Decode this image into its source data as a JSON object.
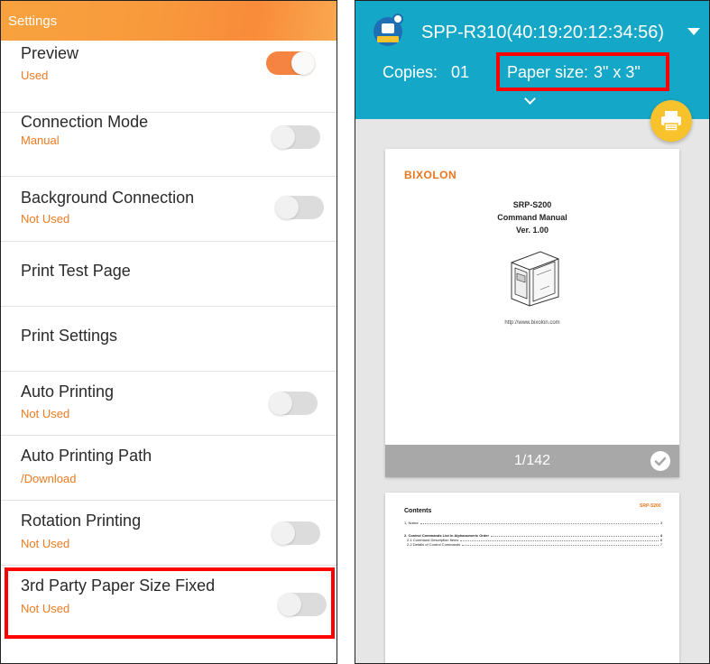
{
  "settings": {
    "header_title": "Settings",
    "items": [
      {
        "title": "Preview",
        "value": "Used",
        "toggle": true
      },
      {
        "title": "Connection Mode",
        "value": "Manual",
        "toggle": false
      },
      {
        "title": "Background Connection",
        "value": "Not Used",
        "toggle": false
      },
      {
        "title": "Print Test Page"
      },
      {
        "title": "Print Settings"
      },
      {
        "title": "Auto Printing",
        "value": "Not Used",
        "toggle": false
      },
      {
        "title": "Auto Printing Path",
        "value": "/Download"
      },
      {
        "title": "Rotation Printing",
        "value": "Not Used",
        "toggle": false
      },
      {
        "title": "3rd Party Paper Size Fixed",
        "value": "Not Used",
        "toggle": false
      }
    ]
  },
  "preview": {
    "device_name": "SPP-R310(40:19:20:12:34:56)",
    "copies_label": "Copies:",
    "copies_value": "01",
    "paper_size_label": "Paper size:",
    "paper_size_value": "3\" x 3\"",
    "page1": {
      "brand": "BIXOLON",
      "title_line1": "SRP-S200",
      "title_line2": "Command Manual",
      "title_line3": "Ver. 1.00",
      "url": "http://www.bixolon.com",
      "page_indicator": "1/142"
    },
    "page2": {
      "brand": "SRP-S200",
      "heading": "Contents",
      "toc": [
        {
          "text": "1. Notice",
          "page": "3"
        },
        {
          "text": "2. Control Commands List in Alphanumeric Order",
          "page": "4"
        },
        {
          "text": "2-1 Command Description Items",
          "page": "6"
        },
        {
          "text": "2-2 Details of Control Commands",
          "page": "7"
        }
      ]
    }
  },
  "colors": {
    "accent_orange": "#f58442",
    "header_teal": "#15a7c7",
    "fab_yellow": "#f7c22b",
    "highlight_red": "#ff0000"
  },
  "icons": [
    "app-printer-icon",
    "dropdown-caret-icon",
    "chevron-down-icon",
    "print-fab-icon",
    "check-icon",
    "printer-illustration"
  ]
}
